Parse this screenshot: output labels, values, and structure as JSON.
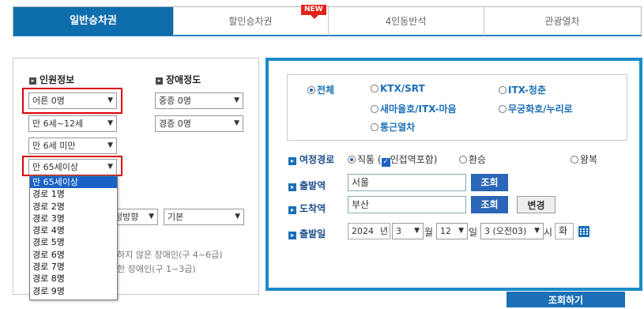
{
  "tabs": [
    {
      "label": "일반승차권",
      "active": true
    },
    {
      "label": "할인승차권",
      "badge": "NEW"
    },
    {
      "label": "4인동반석"
    },
    {
      "label": "관광열차"
    }
  ],
  "passenger": {
    "title": "인원정보",
    "adult": "어른 0명",
    "child": "만 6세~12세",
    "infant": "만 6세 미만",
    "senior": "만 65세이상",
    "senior_options": [
      "만 65세이상",
      "경로 1명",
      "경로 2명",
      "경로 3명",
      "경로 4명",
      "경로 5명",
      "경로 6명",
      "경로 7명",
      "경로 8명",
      "경로 9명"
    ]
  },
  "disability": {
    "title": "장애정도",
    "severe": "중증 0명",
    "mild": "경증 0명"
  },
  "seat": {
    "direction": "정방향",
    "type": "기본"
  },
  "notes": {
    "mild_note": "심하지 않은 장애인(구 4~6급)",
    "severe_note": "심한 장애인(구 1~3급)"
  },
  "train_types": {
    "all": "전체",
    "ktx": "KTX/SRT",
    "itx_cheongchun": "ITX-청춘",
    "saemaeul": "새마을호/ITX-마음",
    "mugunghwa": "무궁화호/누리로",
    "commuter": "통근열차"
  },
  "route": {
    "label": "여정경로",
    "direct": "직통",
    "include_adjacent": "인접역포함",
    "transfer": "환승",
    "round_trip": "왕복"
  },
  "departure_station": {
    "label": "출발역",
    "value": "서울",
    "button": "조회"
  },
  "arrival_station": {
    "label": "도착역",
    "value": "부산",
    "button": "조회",
    "change_button": "변경"
  },
  "date": {
    "label": "출발일",
    "year": "2024",
    "year_unit": "년",
    "month": "3",
    "month_unit": "월",
    "day": "12",
    "day_unit": "일",
    "hour": "3 (오전03)",
    "hour_unit": "시",
    "weekday": "화"
  },
  "search_button": "조회하기"
}
